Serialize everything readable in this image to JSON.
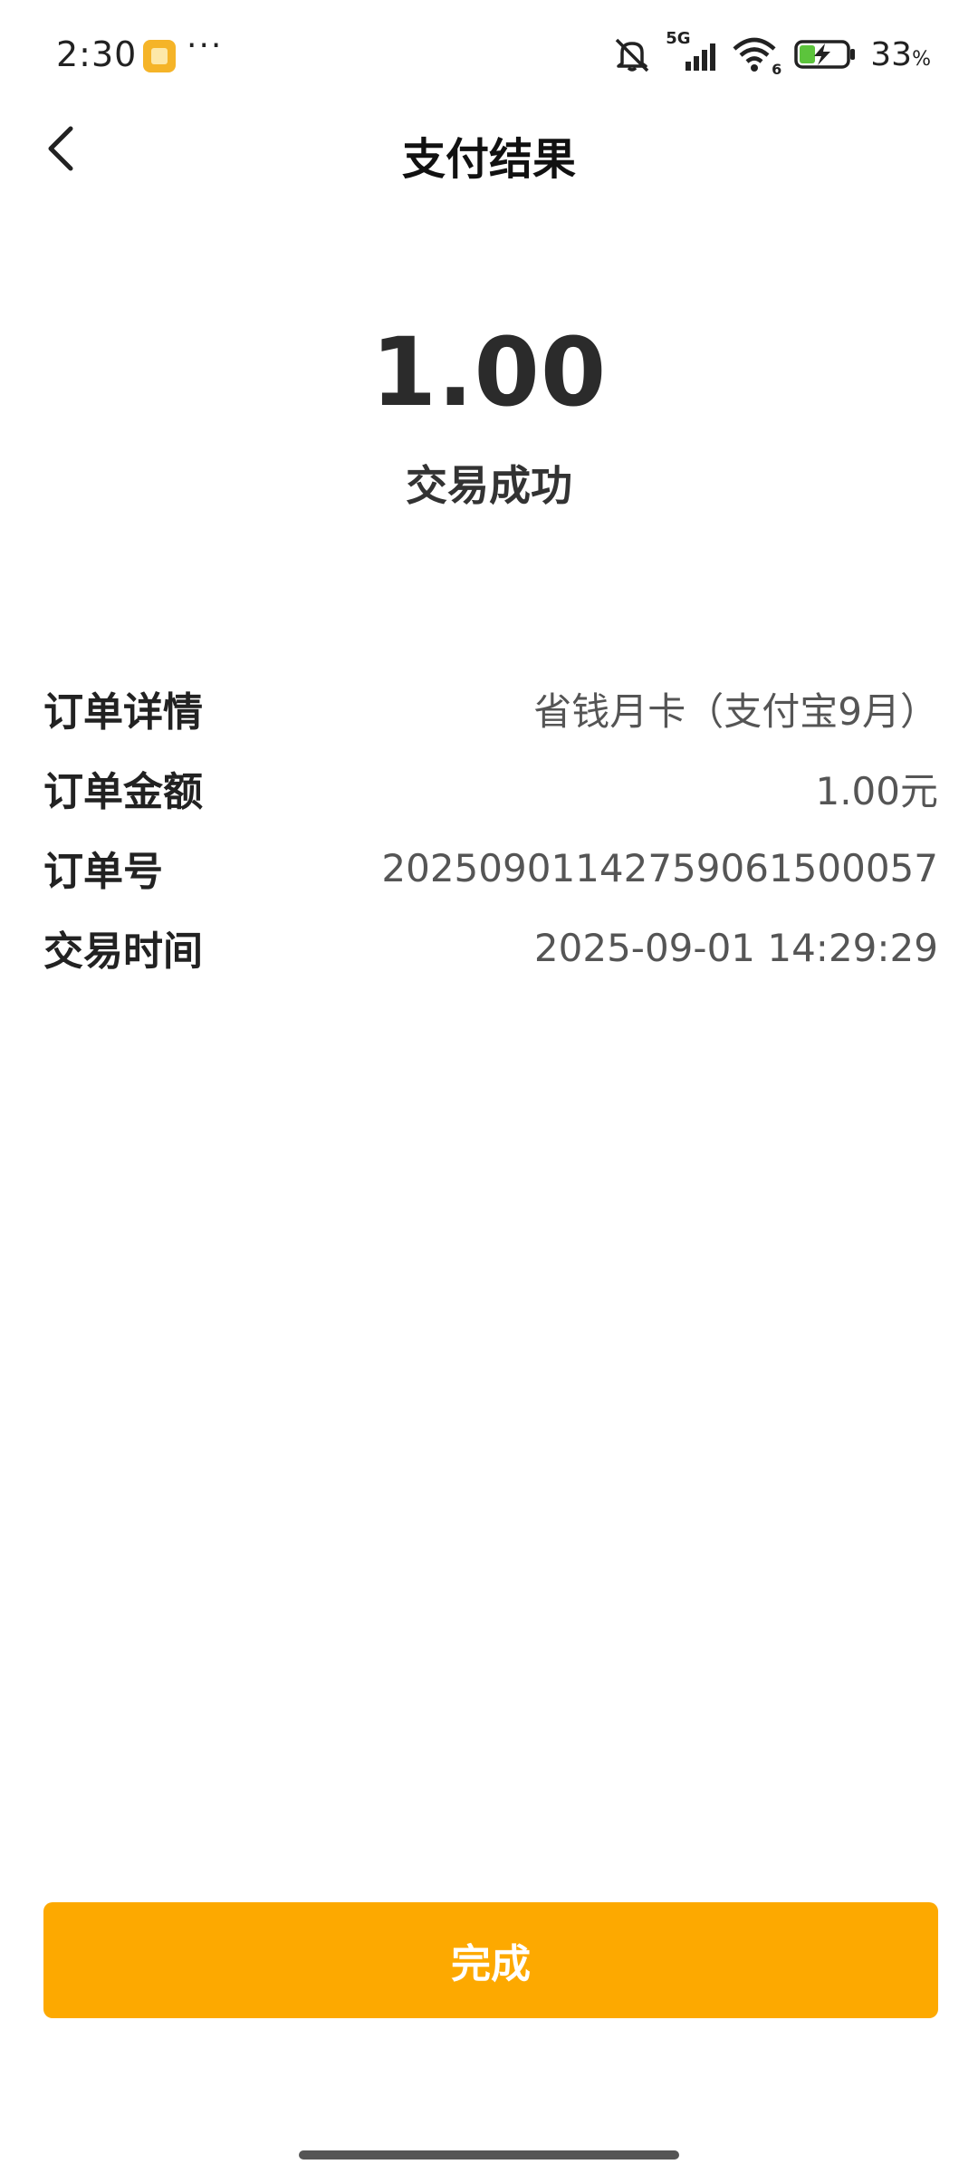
{
  "status_bar": {
    "time": "2:30",
    "more": "···",
    "network_label": "5G",
    "wifi_label": "6",
    "battery_level": "33",
    "battery_unit": "%",
    "icons": [
      "app-notification-icon",
      "mute-icon",
      "signal-icon",
      "wifi-icon",
      "battery-charging-icon"
    ]
  },
  "header": {
    "title": "支付结果",
    "back_icon": "chevron-left-icon"
  },
  "result": {
    "amount": "1.00",
    "status": "交易成功"
  },
  "details": [
    {
      "label": "订单详情",
      "value": "省钱月卡（支付宝9月）"
    },
    {
      "label": "订单金额",
      "value": "1.00元"
    },
    {
      "label": "订单号",
      "value": "20250901142759061500057"
    },
    {
      "label": "交易时间",
      "value": "2025-09-01 14:29:29"
    }
  ],
  "actions": {
    "done_label": "完成"
  },
  "colors": {
    "accent": "#fda900",
    "text_primary": "#222222",
    "text_secondary": "#555555",
    "background": "#ffffff"
  }
}
